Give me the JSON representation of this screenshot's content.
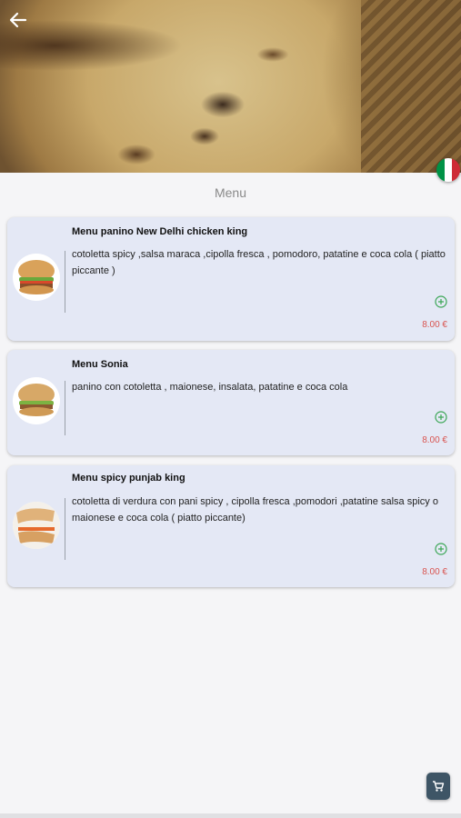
{
  "header": {
    "back_icon": "back-arrow-icon",
    "language_icon": "italy-flag-icon",
    "language_flag_colors": [
      "#009246",
      "#ffffff",
      "#ce2b37"
    ]
  },
  "section": {
    "title": "Menu"
  },
  "items": [
    {
      "title": "Menu panino New Delhi chicken king",
      "description": "cotoletta spicy ,salsa maraca ,cipolla fresca , pomodoro, patatine e coca cola ( piatto piccante )",
      "price": "8.00 €",
      "add_icon": "add-circle-icon"
    },
    {
      "title": "Menu Sonia",
      "description": "panino con cotoletta , maionese, insalata, patatine e coca cola",
      "price": "8.00 €",
      "add_icon": "add-circle-icon"
    },
    {
      "title": "Menu spicy punjab king",
      "description": "cotoletta di verdura con pani spicy , cipolla fresca ,pomodori ,patatine salsa spicy o maionese e coca cola ( piatto piccante)",
      "price": "8.00 €",
      "add_icon": "add-circle-icon"
    }
  ],
  "cart": {
    "icon": "cart-icon"
  },
  "colors": {
    "card_background": "#e4e8f5",
    "price": "#d9534f",
    "add_icon": "#3aa655",
    "cart_button": "#3e5566"
  }
}
